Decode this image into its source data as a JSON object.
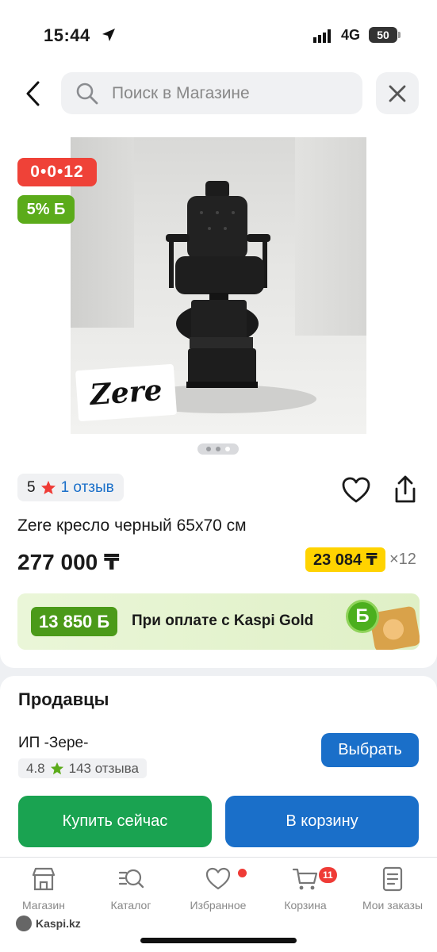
{
  "status_bar": {
    "time": "15:44",
    "network": "4G",
    "battery": "50",
    "icons": [
      "location-arrow-icon",
      "signal-icon"
    ]
  },
  "header": {
    "search_placeholder": "Поиск в Магазине",
    "icons": [
      "back-chevron-icon",
      "search-icon",
      "close-icon"
    ]
  },
  "product": {
    "timer_badge": "0•0•12",
    "bonus_badge": "5% Б",
    "image_logo": "Zere",
    "image_count": 3,
    "image_active_index": 2,
    "rating_value": "5",
    "reviews_label": "1 отзыв",
    "title": "Zere кресло черный 65х70 см",
    "price": "277 000 ₸",
    "installment_amount": "23 084 ₸",
    "installment_months": "×12",
    "gold_bonus_amount": "13 850 Б",
    "gold_bonus_text": "При оплате с Kaspi Gold",
    "gold_coin_glyph": "Б"
  },
  "sellers": {
    "title": "Продавцы",
    "seller_name": "ИП -Зере-",
    "seller_rating": "4.8",
    "seller_reviews": "143 отзыва",
    "select_label": "Выбрать",
    "buy_now_label": "Купить сейчас",
    "add_to_cart_label": "В корзину"
  },
  "tab_bar": {
    "tabs": [
      {
        "label": "Магазин",
        "icon": "store-icon"
      },
      {
        "label": "Каталог",
        "icon": "catalog-search-icon"
      },
      {
        "label": "Избранное",
        "icon": "heart-icon"
      },
      {
        "label": "Корзина",
        "icon": "cart-icon",
        "badge": "11"
      },
      {
        "label": "Мои заказы",
        "icon": "orders-icon"
      }
    ]
  },
  "watermark": "Kaspi.kz",
  "colors": {
    "accent_blue": "#1a6fc9",
    "buy_green": "#1aa351",
    "timer_red": "#ef4238",
    "bonus_green": "#5bab1a",
    "installment_yellow": "#ffd300"
  }
}
